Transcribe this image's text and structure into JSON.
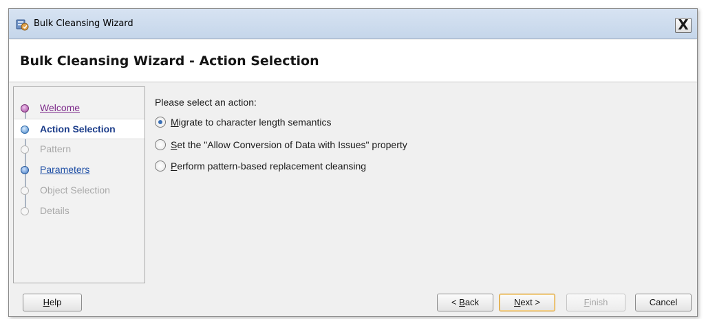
{
  "window": {
    "title": "Bulk Cleansing Wizard",
    "icon": "wizard-app-icon",
    "close_label": "X"
  },
  "header": {
    "title": "Bulk Cleansing Wizard - Action Selection"
  },
  "steps": [
    {
      "label": "Welcome",
      "state": "visited"
    },
    {
      "label": "Action Selection",
      "state": "current"
    },
    {
      "label": "Pattern",
      "state": "disabled"
    },
    {
      "label": "Parameters",
      "state": "link"
    },
    {
      "label": "Object Selection",
      "state": "disabled"
    },
    {
      "label": "Details",
      "state": "disabled"
    }
  ],
  "content": {
    "prompt": "Please select an action:",
    "options": [
      {
        "mnemonic": "M",
        "rest": "igrate to character length semantics",
        "checked": true
      },
      {
        "mnemonic": "S",
        "rest": "et the \"Allow Conversion of Data with Issues\" property",
        "checked": false
      },
      {
        "mnemonic": "P",
        "rest": "erform pattern-based replacement cleansing",
        "checked": false
      }
    ]
  },
  "buttons": {
    "help": {
      "mnemonic": "H",
      "rest": "elp"
    },
    "back": {
      "prefix": "< ",
      "mnemonic": "B",
      "rest": "ack"
    },
    "next": {
      "mnemonic": "N",
      "rest": "ext >"
    },
    "finish": {
      "mnemonic": "F",
      "rest": "inish"
    },
    "cancel": {
      "label": "Cancel"
    }
  },
  "colors": {
    "title_bar": "#c5d6ea",
    "current_step": "#1c3d8a",
    "visited_link": "#7d2a8a",
    "default_button_border": "#d8a13d"
  }
}
